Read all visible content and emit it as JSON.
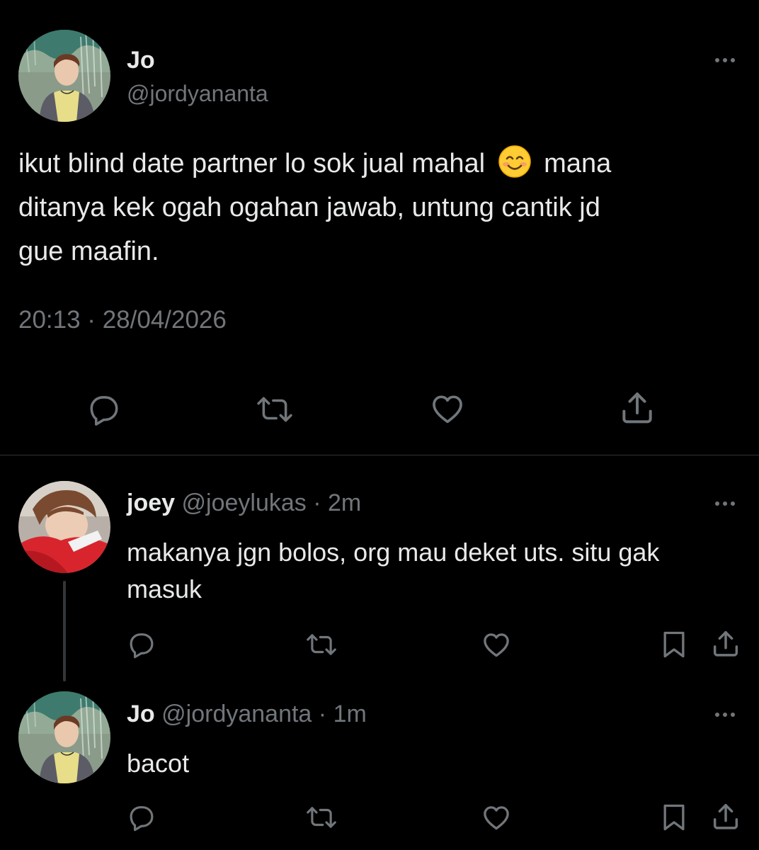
{
  "main_tweet": {
    "display_name": "Jo",
    "handle": "@jordyananta",
    "text_line1": "ikut blind date partner lo sok jual mahal",
    "emoji": "😊",
    "text_line1_after": "mana",
    "text_line2": "ditanya kek ogah ogahan jawab, untung cantik jd",
    "text_line3": "gue maafin.",
    "timestamp": "20:13 · 28/04/2026",
    "actions": [
      "reply-icon",
      "retweet-icon",
      "like-icon",
      "share-icon"
    ]
  },
  "replies": [
    {
      "display_name": "joey",
      "handle": "@joeylukas",
      "dot": "·",
      "time": "2m",
      "text_line1": "makanya jgn bolos, org mau deket uts. situ gak",
      "text_line2": "masuk",
      "actions": [
        "reply-icon",
        "retweet-icon",
        "like-icon",
        "bookmark-icon",
        "share-icon"
      ]
    },
    {
      "display_name": "Jo",
      "handle": "@jordyananta",
      "dot": "·",
      "time": "1m",
      "text_line1": "bacot",
      "actions": [
        "reply-icon",
        "retweet-icon",
        "like-icon",
        "bookmark-icon",
        "share-icon"
      ]
    }
  ],
  "colors": {
    "background": "#000000",
    "text": "#e7e9ea",
    "muted": "#71767b",
    "divider": "#2f3336"
  }
}
